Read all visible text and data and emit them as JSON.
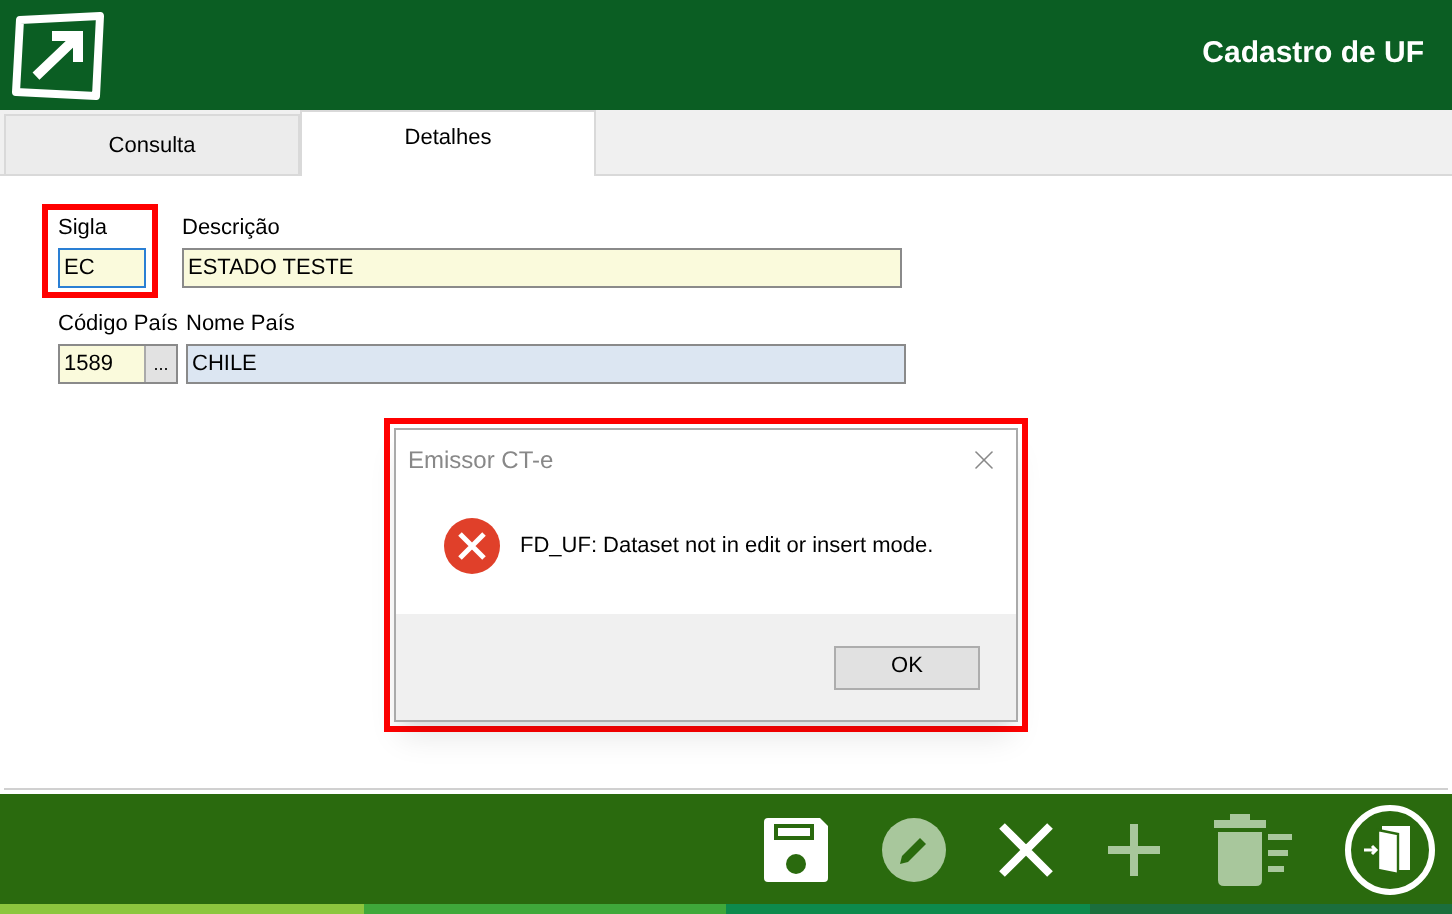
{
  "header": {
    "title": "Cadastro de UF"
  },
  "tabs": [
    {
      "label": "Consulta",
      "selected": false
    },
    {
      "label": "Detalhes",
      "selected": true
    }
  ],
  "fields": [
    {
      "label": "Sigla",
      "value": "EC",
      "focused": true,
      "highlighted": true,
      "readonly": false
    },
    {
      "label": "Descrição",
      "value": "ESTADO TESTE",
      "focused": false,
      "readonly": false
    },
    {
      "label": "Código País",
      "value": "1589",
      "focused": false,
      "readonly": false,
      "lookup": "..."
    },
    {
      "label": "Nome País",
      "value": "CHILE",
      "focused": false,
      "readonly": true
    }
  ],
  "dialog": {
    "title": "Emissor CT-e",
    "message": "FD_UF: Dataset not in edit or insert mode.",
    "button": "OK",
    "highlighted": true
  },
  "toolbar": [
    {
      "kind": "save",
      "disabled": false
    },
    {
      "kind": "edit",
      "disabled": true
    },
    {
      "kind": "cancel",
      "disabled": false
    },
    {
      "kind": "add",
      "disabled": true
    },
    {
      "kind": "delete",
      "disabled": true
    },
    {
      "kind": "exit",
      "disabled": false
    }
  ],
  "stripe": [
    {
      "color": "#8cc63e"
    },
    {
      "color": "#3fa83a"
    },
    {
      "color": "#0d8a4c"
    },
    {
      "color": "#1b6e3c"
    }
  ]
}
